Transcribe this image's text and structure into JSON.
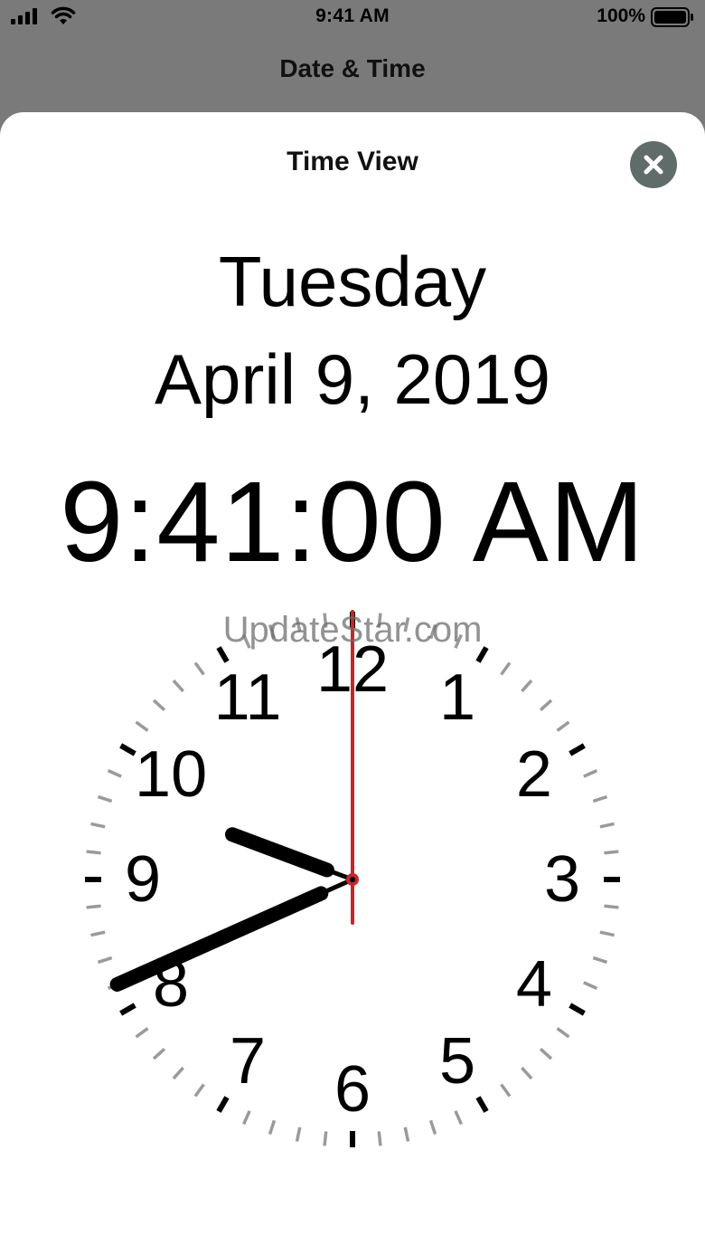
{
  "status_bar": {
    "time": "9:41 AM",
    "battery_percent": "100%",
    "signal_icon": "cellular-signal-icon",
    "wifi_icon": "wifi-icon",
    "battery_icon": "battery-icon"
  },
  "nav": {
    "title": "Date & Time"
  },
  "sheet": {
    "title": "Time View",
    "close_icon": "close-icon"
  },
  "date_display": {
    "day": "Tuesday",
    "date": "April 9, 2019"
  },
  "digital_clock": {
    "time": "9:41:00 AM"
  },
  "analog_clock": {
    "hours": 9,
    "minutes": 41,
    "seconds": 0,
    "numerals": [
      "12",
      "1",
      "2",
      "3",
      "4",
      "5",
      "6",
      "7",
      "8",
      "9",
      "10",
      "11"
    ],
    "colors": {
      "hands": "#000000",
      "second_hand": "#c4262a",
      "major_tick": "#000000",
      "minor_tick": "#9a9a9a"
    }
  },
  "watermark": {
    "text": "UpdateStar.com"
  },
  "colors": {
    "backdrop": "#7a7a7a",
    "sheet_background": "#ffffff",
    "close_button": "#5f6c69"
  }
}
